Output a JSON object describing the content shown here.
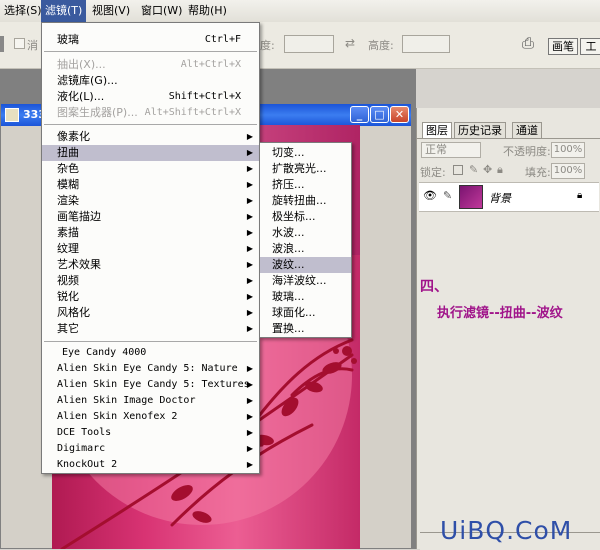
{
  "menubar": {
    "items": [
      {
        "label": "选择(S)"
      },
      {
        "label": "滤镜(T)"
      },
      {
        "label": "视图(V)"
      },
      {
        "label": "窗口(W)"
      },
      {
        "label": "帮助(H)"
      }
    ]
  },
  "options": {
    "clear_label": "消",
    "width_label": "度:",
    "height_label": "高度:",
    "brush_label": "画笔",
    "tools_label": "工"
  },
  "document": {
    "title": "333"
  },
  "filter_menu": {
    "top": [
      {
        "label": "玻璃",
        "shortcut": "Ctrl+F",
        "disabled": false
      },
      {
        "label": "抽出(X)...",
        "shortcut": "Alt+Ctrl+X",
        "disabled": true
      },
      {
        "label": "滤镜库(G)...",
        "shortcut": "",
        "disabled": false
      },
      {
        "label": "液化(L)...",
        "shortcut": "Shift+Ctrl+X",
        "disabled": false
      },
      {
        "label": "图案生成器(P)...",
        "shortcut": "Alt+Shift+Ctrl+X",
        "disabled": true
      }
    ],
    "groups": [
      {
        "label": "像素化"
      },
      {
        "label": "扭曲"
      },
      {
        "label": "杂色"
      },
      {
        "label": "模糊"
      },
      {
        "label": "渲染"
      },
      {
        "label": "画笔描边"
      },
      {
        "label": "素描"
      },
      {
        "label": "纹理"
      },
      {
        "label": "艺术效果"
      },
      {
        "label": "视频"
      },
      {
        "label": "锐化"
      },
      {
        "label": "风格化"
      },
      {
        "label": "其它"
      }
    ],
    "plugins": [
      {
        "label": "Eye Candy 4000",
        "submenu": false
      },
      {
        "label": "Alien Skin Eye Candy 5: Nature",
        "submenu": true
      },
      {
        "label": "Alien Skin Eye Candy 5: Textures",
        "submenu": true
      },
      {
        "label": "Alien Skin Image Doctor",
        "submenu": true
      },
      {
        "label": "Alien Skin Xenofex 2",
        "submenu": true
      },
      {
        "label": "DCE Tools",
        "submenu": true
      },
      {
        "label": "Digimarc",
        "submenu": true
      },
      {
        "label": "KnockOut 2",
        "submenu": true
      }
    ]
  },
  "distort_menu": {
    "items": [
      {
        "label": "切变..."
      },
      {
        "label": "扩散亮光..."
      },
      {
        "label": "挤压..."
      },
      {
        "label": "旋转扭曲..."
      },
      {
        "label": "极坐标..."
      },
      {
        "label": "水波..."
      },
      {
        "label": "波浪..."
      },
      {
        "label": "波纹..."
      },
      {
        "label": "海洋波纹..."
      },
      {
        "label": "玻璃..."
      },
      {
        "label": "球面化..."
      },
      {
        "label": "置换..."
      }
    ]
  },
  "layers_panel": {
    "tabs": [
      {
        "label": "图层"
      },
      {
        "label": "历史记录"
      },
      {
        "label": "通道"
      }
    ],
    "blend_mode": "正常",
    "opacity_label": "不透明度:",
    "opacity_value": "100%",
    "lock_label": "锁定:",
    "fill_label": "填充:",
    "fill_value": "100%",
    "layer_name": "背景"
  },
  "annotation": {
    "step": "四、",
    "text": "执行滤镜--扭曲--波纹"
  },
  "watermark": "UiBQ.CoM"
}
